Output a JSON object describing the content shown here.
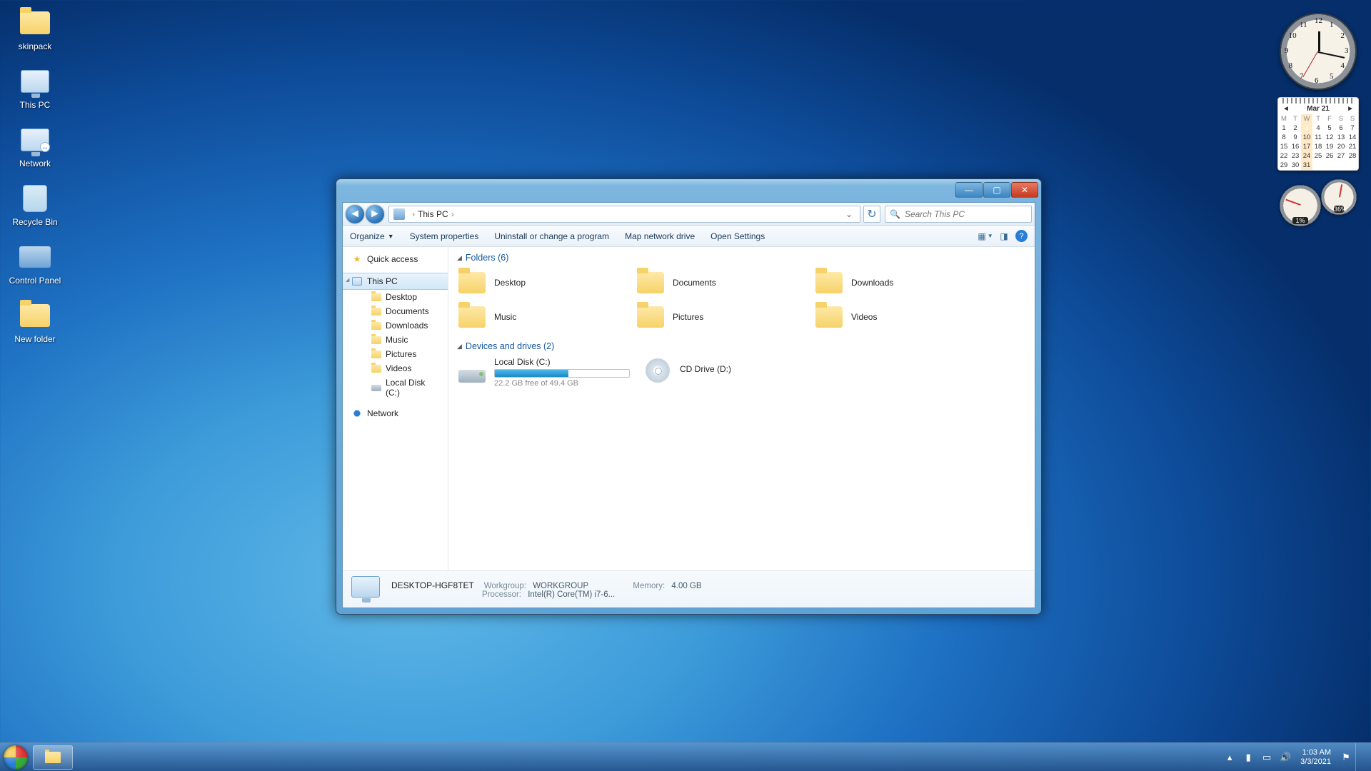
{
  "desktop_icons": [
    {
      "name": "skinpack"
    },
    {
      "name": "This PC"
    },
    {
      "name": "Network"
    },
    {
      "name": "Recycle Bin"
    },
    {
      "name": "Control Panel"
    },
    {
      "name": "New folder"
    }
  ],
  "taskbar": {
    "time": "1:03 AM",
    "date": "3/3/2021"
  },
  "gadgets": {
    "clock_numbers": [
      "12",
      "1",
      "2",
      "3",
      "4",
      "5",
      "6",
      "7",
      "8",
      "9",
      "10",
      "11"
    ],
    "calendar": {
      "title": "Mar 21",
      "dow": [
        "M",
        "T",
        "W",
        "T",
        "F",
        "S",
        "S"
      ],
      "weeks": [
        [
          "1",
          "2",
          "3",
          "4",
          "5",
          "6",
          "7"
        ],
        [
          "8",
          "9",
          "10",
          "11",
          "12",
          "13",
          "14"
        ],
        [
          "15",
          "16",
          "17",
          "18",
          "19",
          "20",
          "21"
        ],
        [
          "22",
          "23",
          "24",
          "25",
          "26",
          "27",
          "28"
        ],
        [
          "29",
          "30",
          "31",
          "",
          "",
          "",
          ""
        ]
      ],
      "today": "3",
      "today_col": 2
    },
    "cpu": {
      "label": "1%"
    },
    "ram": {
      "label": "36%"
    }
  },
  "explorer": {
    "breadcrumb": {
      "root_icon": "computer",
      "location": "This PC"
    },
    "search_placeholder": "Search This PC",
    "cmdbar": [
      "Organize",
      "System properties",
      "Uninstall or change a program",
      "Map network drive",
      "Open Settings"
    ],
    "nav": {
      "quick_access": "Quick access",
      "this_pc": "This PC",
      "children": [
        "Desktop",
        "Documents",
        "Downloads",
        "Music",
        "Pictures",
        "Videos",
        "Local Disk (C:)"
      ],
      "network": "Network"
    },
    "groups": {
      "folders": {
        "header": "Folders (6)",
        "items": [
          "Desktop",
          "Documents",
          "Downloads",
          "Music",
          "Pictures",
          "Videos"
        ]
      },
      "drives": {
        "header": "Devices and drives (2)",
        "local": {
          "name": "Local Disk (C:)",
          "free": "22.2 GB free of 49.4 GB",
          "used_pct": 55
        },
        "cd": {
          "name": "CD Drive (D:)"
        }
      }
    },
    "details": {
      "host": "DESKTOP-HGF8TET",
      "workgroup_label": "Workgroup:",
      "workgroup": "WORKGROUP",
      "memory_label": "Memory:",
      "memory": "4.00 GB",
      "processor_label": "Processor:",
      "processor": "Intel(R) Core(TM) i7-6..."
    }
  }
}
